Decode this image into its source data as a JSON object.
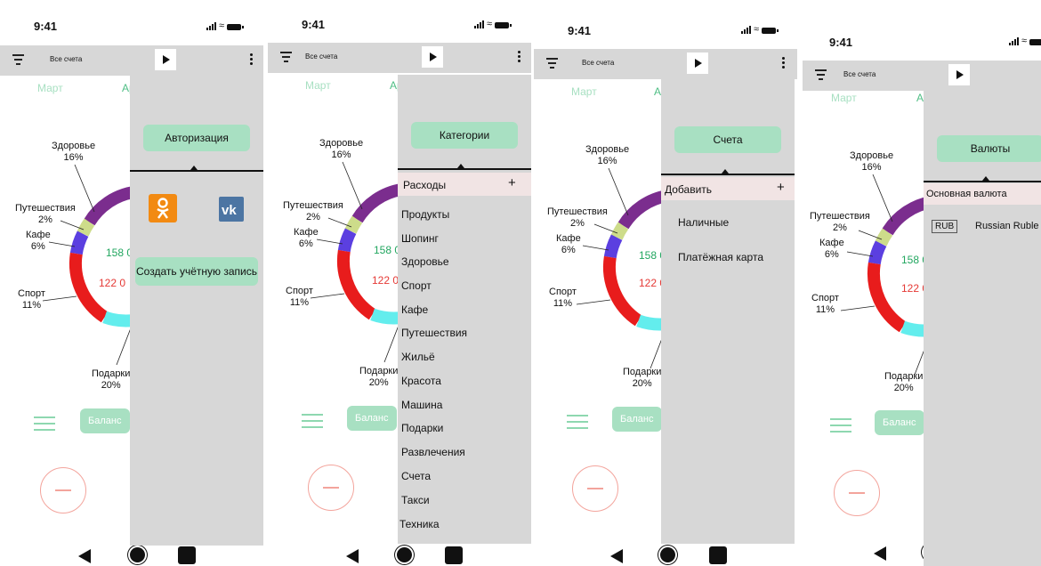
{
  "status_time": "9:41",
  "toolbar_title": "Все счета",
  "months": [
    "Март",
    "Ap"
  ],
  "categories": [
    {
      "name": "Здоровье",
      "pct": "16%"
    },
    {
      "name": "Путешествия",
      "pct": "2%"
    },
    {
      "name": "Кафе",
      "pct": "6%"
    },
    {
      "name": "Спорт",
      "pct": "11%"
    },
    {
      "name": "Подарки",
      "pct": "20%"
    }
  ],
  "amount_income": "158 0",
  "amount_expense": "122 0",
  "balance_label": "Баланс",
  "colors": {
    "accent": "#a8e0c2",
    "drawer": "#d7d7d7",
    "expense": "#e53935",
    "income": "#21a65f"
  },
  "screens": [
    {
      "drawer_button": "Авторизация",
      "social": [
        "odnoklassniki-icon",
        "vk-icon"
      ],
      "create_account": "Создать учётную запись"
    },
    {
      "drawer_button": "Категории",
      "section": "Расходы",
      "items": [
        "Продукты",
        "Шопинг",
        "Здоровье",
        "Спорт",
        "Кафе",
        "Путешествия",
        "Жильё",
        "Красота",
        "Машина",
        "Подарки",
        "Развлечения",
        "Счета",
        "Такси",
        "Техника"
      ]
    },
    {
      "drawer_button": "Счета",
      "section": "Добавить",
      "items": [
        "Наличные",
        "Платёжная карта"
      ]
    },
    {
      "drawer_button": "Валюты",
      "section": "Основная валюта",
      "currency_code": "RUB",
      "currency_name": "Russian Ruble"
    }
  ]
}
